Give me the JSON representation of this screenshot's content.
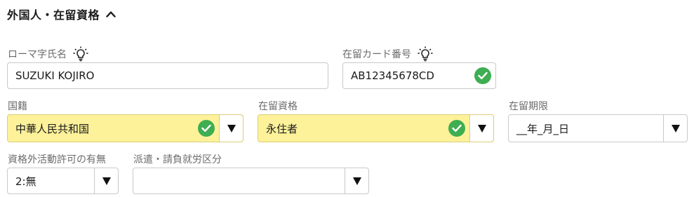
{
  "section": {
    "title": "外国人・在留資格"
  },
  "fields": {
    "romaji_name": {
      "label": "ローマ字氏名",
      "value": "SUZUKI KOJIRO"
    },
    "card_number": {
      "label": "在留カード番号",
      "value": "AB12345678CD"
    },
    "nationality": {
      "label": "国籍",
      "value": "中華人民共和国"
    },
    "status": {
      "label": "在留資格",
      "value": "永住者"
    },
    "period": {
      "label": "在留期限",
      "value": "__年_月_日"
    },
    "work_permit": {
      "label": "資格外活動許可の有無",
      "value": "2:無"
    },
    "dispatch": {
      "label": "派遣・請負就労区分",
      "value": ""
    }
  },
  "colors": {
    "highlight": "#fdf19a",
    "check": "#3fae52",
    "label": "#6b6b6b"
  }
}
